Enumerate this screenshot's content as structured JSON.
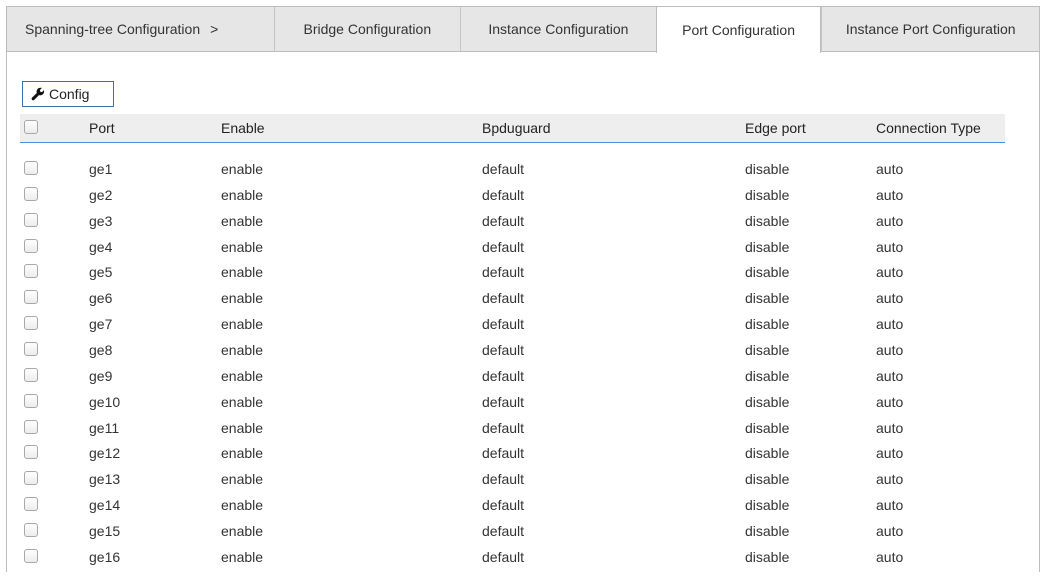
{
  "breadcrumb": {
    "label": "Spanning-tree Configuration",
    "separator": ">"
  },
  "tabs": [
    {
      "label": "Bridge Configuration",
      "active": false
    },
    {
      "label": "Instance Configuration",
      "active": false
    },
    {
      "label": "Port Configuration",
      "active": true
    },
    {
      "label": "Instance Port Configuration",
      "active": false
    }
  ],
  "toolbar": {
    "config_label": "Config",
    "config_icon": "wrench-icon"
  },
  "table": {
    "headers": {
      "port": "Port",
      "enable": "Enable",
      "bpduguard": "Bpduguard",
      "edge_port": "Edge port",
      "connection_type": "Connection Type"
    },
    "rows": [
      {
        "port": "ge1",
        "enable": "enable",
        "bpduguard": "default",
        "edge_port": "disable",
        "connection_type": "auto"
      },
      {
        "port": "ge2",
        "enable": "enable",
        "bpduguard": "default",
        "edge_port": "disable",
        "connection_type": "auto"
      },
      {
        "port": "ge3",
        "enable": "enable",
        "bpduguard": "default",
        "edge_port": "disable",
        "connection_type": "auto"
      },
      {
        "port": "ge4",
        "enable": "enable",
        "bpduguard": "default",
        "edge_port": "disable",
        "connection_type": "auto"
      },
      {
        "port": "ge5",
        "enable": "enable",
        "bpduguard": "default",
        "edge_port": "disable",
        "connection_type": "auto"
      },
      {
        "port": "ge6",
        "enable": "enable",
        "bpduguard": "default",
        "edge_port": "disable",
        "connection_type": "auto"
      },
      {
        "port": "ge7",
        "enable": "enable",
        "bpduguard": "default",
        "edge_port": "disable",
        "connection_type": "auto"
      },
      {
        "port": "ge8",
        "enable": "enable",
        "bpduguard": "default",
        "edge_port": "disable",
        "connection_type": "auto"
      },
      {
        "port": "ge9",
        "enable": "enable",
        "bpduguard": "default",
        "edge_port": "disable",
        "connection_type": "auto"
      },
      {
        "port": "ge10",
        "enable": "enable",
        "bpduguard": "default",
        "edge_port": "disable",
        "connection_type": "auto"
      },
      {
        "port": "ge11",
        "enable": "enable",
        "bpduguard": "default",
        "edge_port": "disable",
        "connection_type": "auto"
      },
      {
        "port": "ge12",
        "enable": "enable",
        "bpduguard": "default",
        "edge_port": "disable",
        "connection_type": "auto"
      },
      {
        "port": "ge13",
        "enable": "enable",
        "bpduguard": "default",
        "edge_port": "disable",
        "connection_type": "auto"
      },
      {
        "port": "ge14",
        "enable": "enable",
        "bpduguard": "default",
        "edge_port": "disable",
        "connection_type": "auto"
      },
      {
        "port": "ge15",
        "enable": "enable",
        "bpduguard": "default",
        "edge_port": "disable",
        "connection_type": "auto"
      },
      {
        "port": "ge16",
        "enable": "enable",
        "bpduguard": "default",
        "edge_port": "disable",
        "connection_type": "auto"
      }
    ]
  },
  "colors": {
    "accent": "#4a90d9",
    "button_border": "#3b6fb6",
    "tabbar_bg": "#e6e6e6"
  }
}
